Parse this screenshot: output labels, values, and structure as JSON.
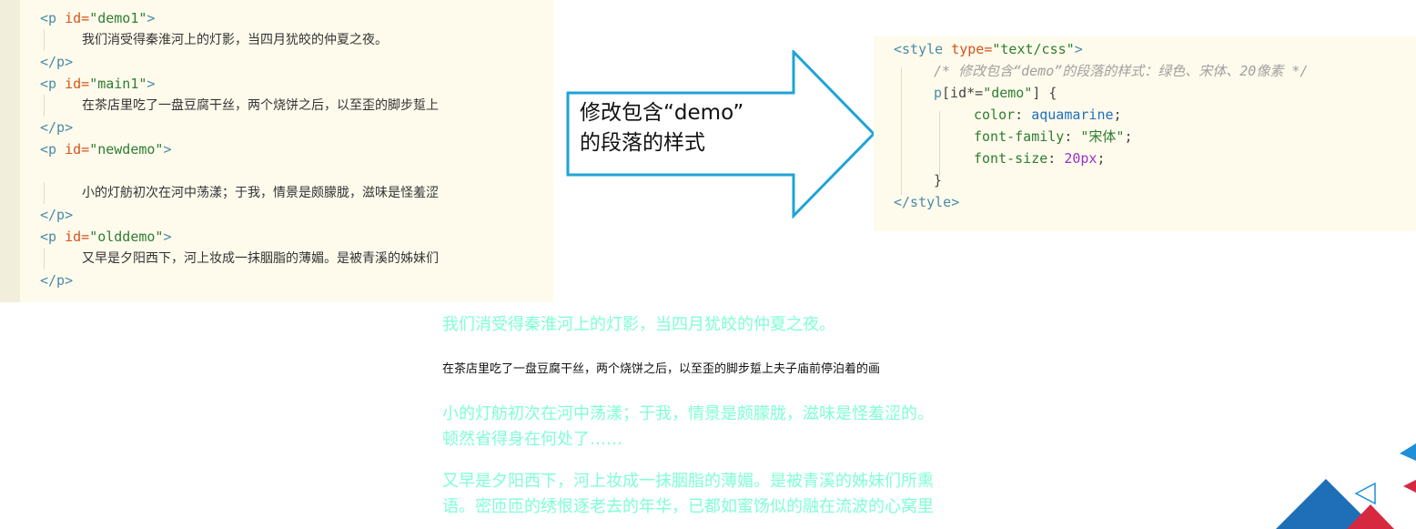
{
  "code_left": {
    "l1": {
      "open": "<p",
      "attr": "id=",
      "val": "\"demo1\"",
      "close": ">"
    },
    "l2": "我们消受得秦淮河上的灯影，当四月犹皎的仲夏之夜。",
    "l3": "</p>",
    "l4": {
      "open": "<p",
      "attr": "id=",
      "val": "\"main1\"",
      "close": ">"
    },
    "l5": "在茶店里吃了一盘豆腐干丝，两个烧饼之后，以至歪的脚步踅上",
    "l6": "</p>",
    "l7": {
      "open": "<p",
      "attr": "id=",
      "val": "\"newdemo\"",
      "close": ">"
    },
    "l8": "小的灯舫初次在河中荡漾；于我，情景是颇朦胧，滋味是怪羞涩",
    "l9": "</p>",
    "l10": {
      "open": "<p",
      "attr": "id=",
      "val": "\"olddemo\"",
      "close": ">"
    },
    "l11": "又早是夕阳西下，河上妆成一抹胭脂的薄媚。是被青溪的姊妹们",
    "l12": "</p>"
  },
  "callout": {
    "line1": "修改包含“demo”",
    "line2": "的段落的样式"
  },
  "code_right": {
    "l1": {
      "open": "<style",
      "attr": "type=",
      "val": "\"text/css\"",
      "close": ">"
    },
    "l2": "/* 修改包含“demo”的段落的样式：绿色、宋体、20像素 */",
    "l3": {
      "sel_tag": "p",
      "sel_attr": "[id*=",
      "sel_val": "\"demo\"",
      "sel_end": "] {"
    },
    "l4": {
      "prop": "color",
      "val": "aquamarine"
    },
    "l5": {
      "prop": "font-family",
      "val": "\"宋体\""
    },
    "l6": {
      "prop": "font-size",
      "val": "20px"
    },
    "l7": "}",
    "l8": "</style>"
  },
  "result": {
    "p1": "我们消受得秦淮河上的灯影，当四月犹皎的仲夏之夜。",
    "p2": "在茶店里吃了一盘豆腐干丝，两个烧饼之后，以至歪的脚步踅上夫子庙前停泊着的画",
    "p3a": "小的灯舫初次在河中荡漾；于我，情景是颇朦胧，滋味是怪羞涩的。",
    "p3b": "顿然省得身在何处了……",
    "p4a": "又早是夕阳西下，河上妆成一抹胭脂的薄媚。是被青溪的姊妹们所熏",
    "p4b": "语。密匝匝的绣恨逐老去的年华，已都如蜜饧似的融在流波的心窝里"
  },
  "colors": {
    "aquamarine": "#7fffd4",
    "arrow_stroke": "#1fa3d8",
    "code_bg": "#fefbec"
  }
}
